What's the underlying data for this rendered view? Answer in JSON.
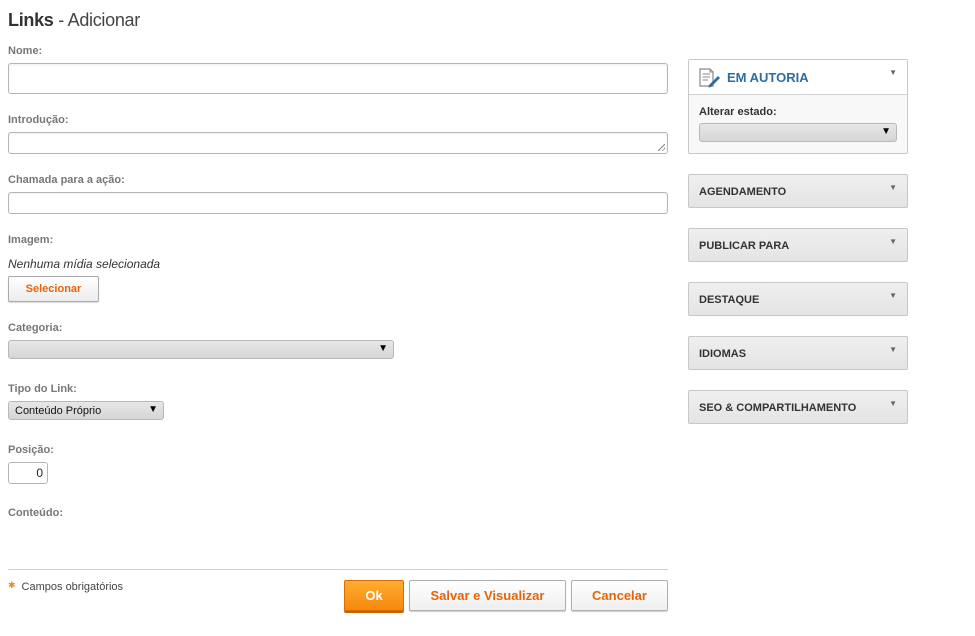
{
  "header": {
    "title": "Links",
    "subtitle": "- Adicionar"
  },
  "form": {
    "name_label": "Nome:",
    "intro_label": "Introdução:",
    "cta_label": "Chamada para a ação:",
    "image_label": "Imagem:",
    "no_media_text": "Nenhuma mídia selecionada",
    "select_button": "Selecionar",
    "category_label": "Categoria:",
    "category_value": "",
    "link_type_label": "Tipo do Link:",
    "link_type_value": "Conteúdo Próprio",
    "position_label": "Posição:",
    "position_value": "0",
    "content_label": "Conteúdo:",
    "required_note": "Campos obrigatórios"
  },
  "actions": {
    "ok": "Ok",
    "save_view": "Salvar e Visualizar",
    "cancel": "Cancelar"
  },
  "sidebar": {
    "status_panel": {
      "title": "EM AUTORIA",
      "state_label": "Alterar estado:",
      "state_value": ""
    },
    "panels": [
      {
        "title": "AGENDAMENTO"
      },
      {
        "title": "PUBLICAR PARA"
      },
      {
        "title": "DESTAQUE"
      },
      {
        "title": "IDIOMAS"
      },
      {
        "title": "SEO & COMPARTILHAMENTO"
      }
    ]
  },
  "icons": {
    "collapse_toggle": "triangle-down-icon",
    "status_icon": "document-edit-icon",
    "required_marker": "asterisk-icon",
    "select_arrow": "caret-down-icon"
  },
  "colors": {
    "accent_orange": "#f6890d",
    "link_orange": "#e5650a",
    "status_blue": "#2d6ea1"
  }
}
